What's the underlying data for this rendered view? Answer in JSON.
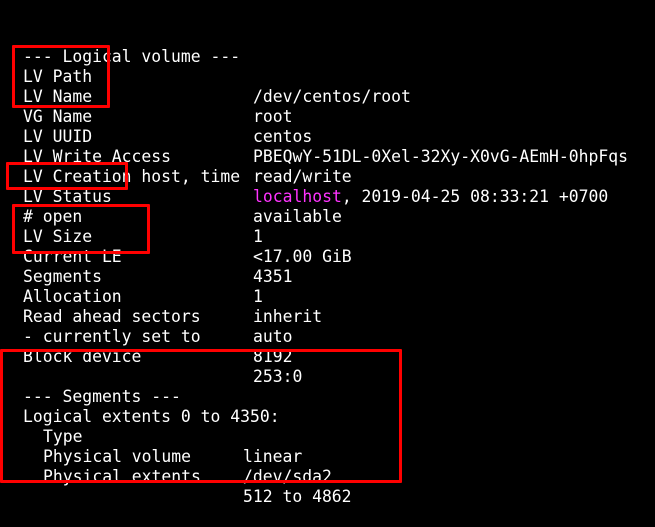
{
  "lv_section": {
    "header": "--- Logical volume ---",
    "rows": [
      {
        "key": "LV Path",
        "value": "/dev/centos/root"
      },
      {
        "key": "LV Name",
        "value": "root"
      },
      {
        "key": "VG Name",
        "value": "centos"
      },
      {
        "key": "LV UUID",
        "value": "PBEQwY-51DL-0Xel-32Xy-X0vG-AEmH-0hpFqs"
      },
      {
        "key": "LV Write Access",
        "value": "read/write"
      },
      {
        "key": "LV Creation host, time",
        "value_host": "localhost",
        "value_rest": ", 2019-04-25 08:33:21 +0700"
      },
      {
        "key": "LV Status",
        "value": "available"
      },
      {
        "key": "# open",
        "value": "1"
      },
      {
        "key": "LV Size",
        "value": "<17.00 GiB"
      },
      {
        "key": "Current LE",
        "value": "4351"
      },
      {
        "key": "Segments",
        "value": "1"
      },
      {
        "key": "Allocation",
        "value": "inherit"
      },
      {
        "key": "Read ahead sectors",
        "value": "auto"
      },
      {
        "key": "- currently set to",
        "value": "8192"
      },
      {
        "key": "Block device",
        "value": "253:0"
      }
    ]
  },
  "segments_section": {
    "header": "--- Segments ---",
    "extents_line": "Logical extents 0 to 4350:",
    "rows": [
      {
        "key": "Type",
        "value": "linear"
      },
      {
        "key": "Physical volume",
        "value": "/dev/sda2"
      },
      {
        "key": "Physical extents",
        "value": "512 to 4862"
      }
    ]
  },
  "colors": {
    "background": "#000000",
    "text": "#ffffff",
    "hostname": "#ff33ff",
    "highlight_box": "#ff0000"
  }
}
